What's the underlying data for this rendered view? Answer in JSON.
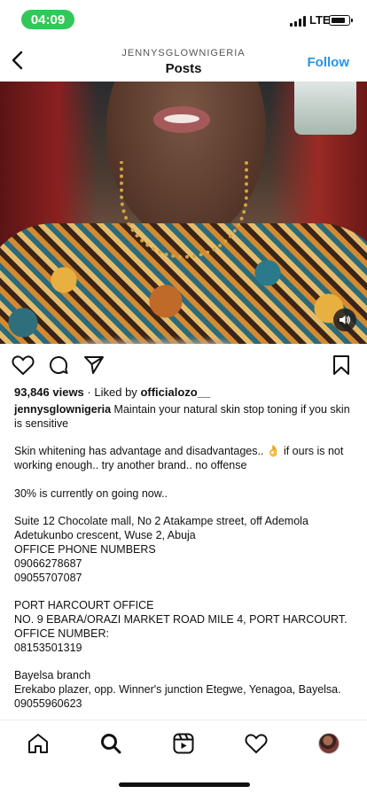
{
  "status_bar": {
    "time": "04:09",
    "network": "LTE"
  },
  "header": {
    "account": "JENNYSGLOWNIGERIA",
    "title": "Posts",
    "follow_label": "Follow",
    "accent_color": "#2795e6"
  },
  "post": {
    "views": "93,846 views",
    "separator": "·",
    "liked_by_prefix": "Liked by",
    "liked_by_user": "officialozo__",
    "caption_user": "jennysglownigeria",
    "caption_first": "Maintain your natural skin stop toning if you skin is sensitive",
    "caption_lines": [
      "",
      "Skin whitening has advantage and disadvantages.. 👌 if ours is not working enough.. try another brand.. no offense",
      "",
      "30% is currently on going now..",
      "",
      "Suite 12 Chocolate mall,  No 2 Atakampe street, off Ademola Adetukunbo crescent, Wuse 2, Abuja",
      "OFFICE PHONE NUMBERS",
      "09066278687",
      "09055707087",
      "",
      "PORT HARCOURT OFFICE",
      "NO. 9 EBARA/ORAZI MARKET ROAD MILE 4, PORT HARCOURT.",
      "OFFICE NUMBER:",
      "08153501319",
      "",
      "Bayelsa branch",
      "Erekabo plazer, opp. Winner's junction Etegwe, Yenagoa, Bayelsa.",
      "09055960623"
    ]
  },
  "icons": {
    "back": "chevron-left-icon",
    "sound": "speaker-icon",
    "like": "heart-icon",
    "comment": "comment-icon",
    "share": "paper-plane-icon",
    "save": "bookmark-icon"
  },
  "bottom_nav": [
    "home-icon",
    "search-icon",
    "reels-icon",
    "heart-icon",
    "profile-avatar"
  ]
}
